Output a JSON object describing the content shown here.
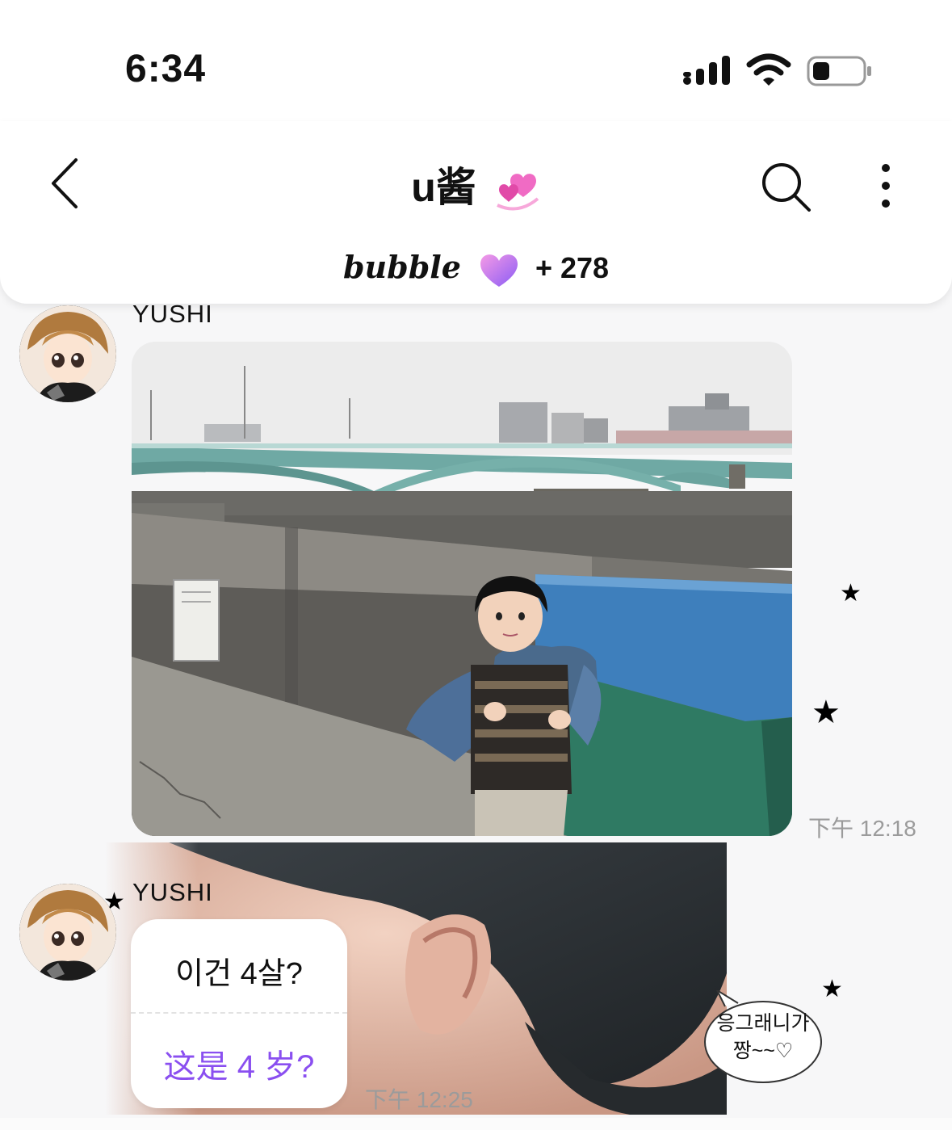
{
  "status_bar": {
    "time": "6:34",
    "signal_icon": "signal-bars-icon",
    "wifi_icon": "wifi-icon",
    "battery_icon": "battery-low-icon"
  },
  "header": {
    "title": "u酱",
    "title_emoji": "revolving-hearts-icon",
    "back_icon": "chevron-left-icon",
    "search_icon": "search-icon",
    "more_icon": "more-vertical-icon",
    "brand": "bubble",
    "brand_icon": "bubble-heart-icon",
    "member_count": "+ 278"
  },
  "messages": [
    {
      "sender": "YUSHI",
      "type": "photo",
      "content_desc": "child-by-river-bridge",
      "timestamp": "下午 12:18"
    },
    {
      "sender": "YUSHI",
      "type": "text",
      "text_original": "이건 4살?",
      "text_translation": "这是 4 岁?",
      "timestamp": "下午 12:25"
    }
  ],
  "background_sticker": {
    "speech_text_line1": "응그래니가",
    "speech_text_line2": "짱~~♡"
  },
  "colors": {
    "accent_purple": "#8a4ff0",
    "timestamp_gray": "#9b9b9b"
  }
}
